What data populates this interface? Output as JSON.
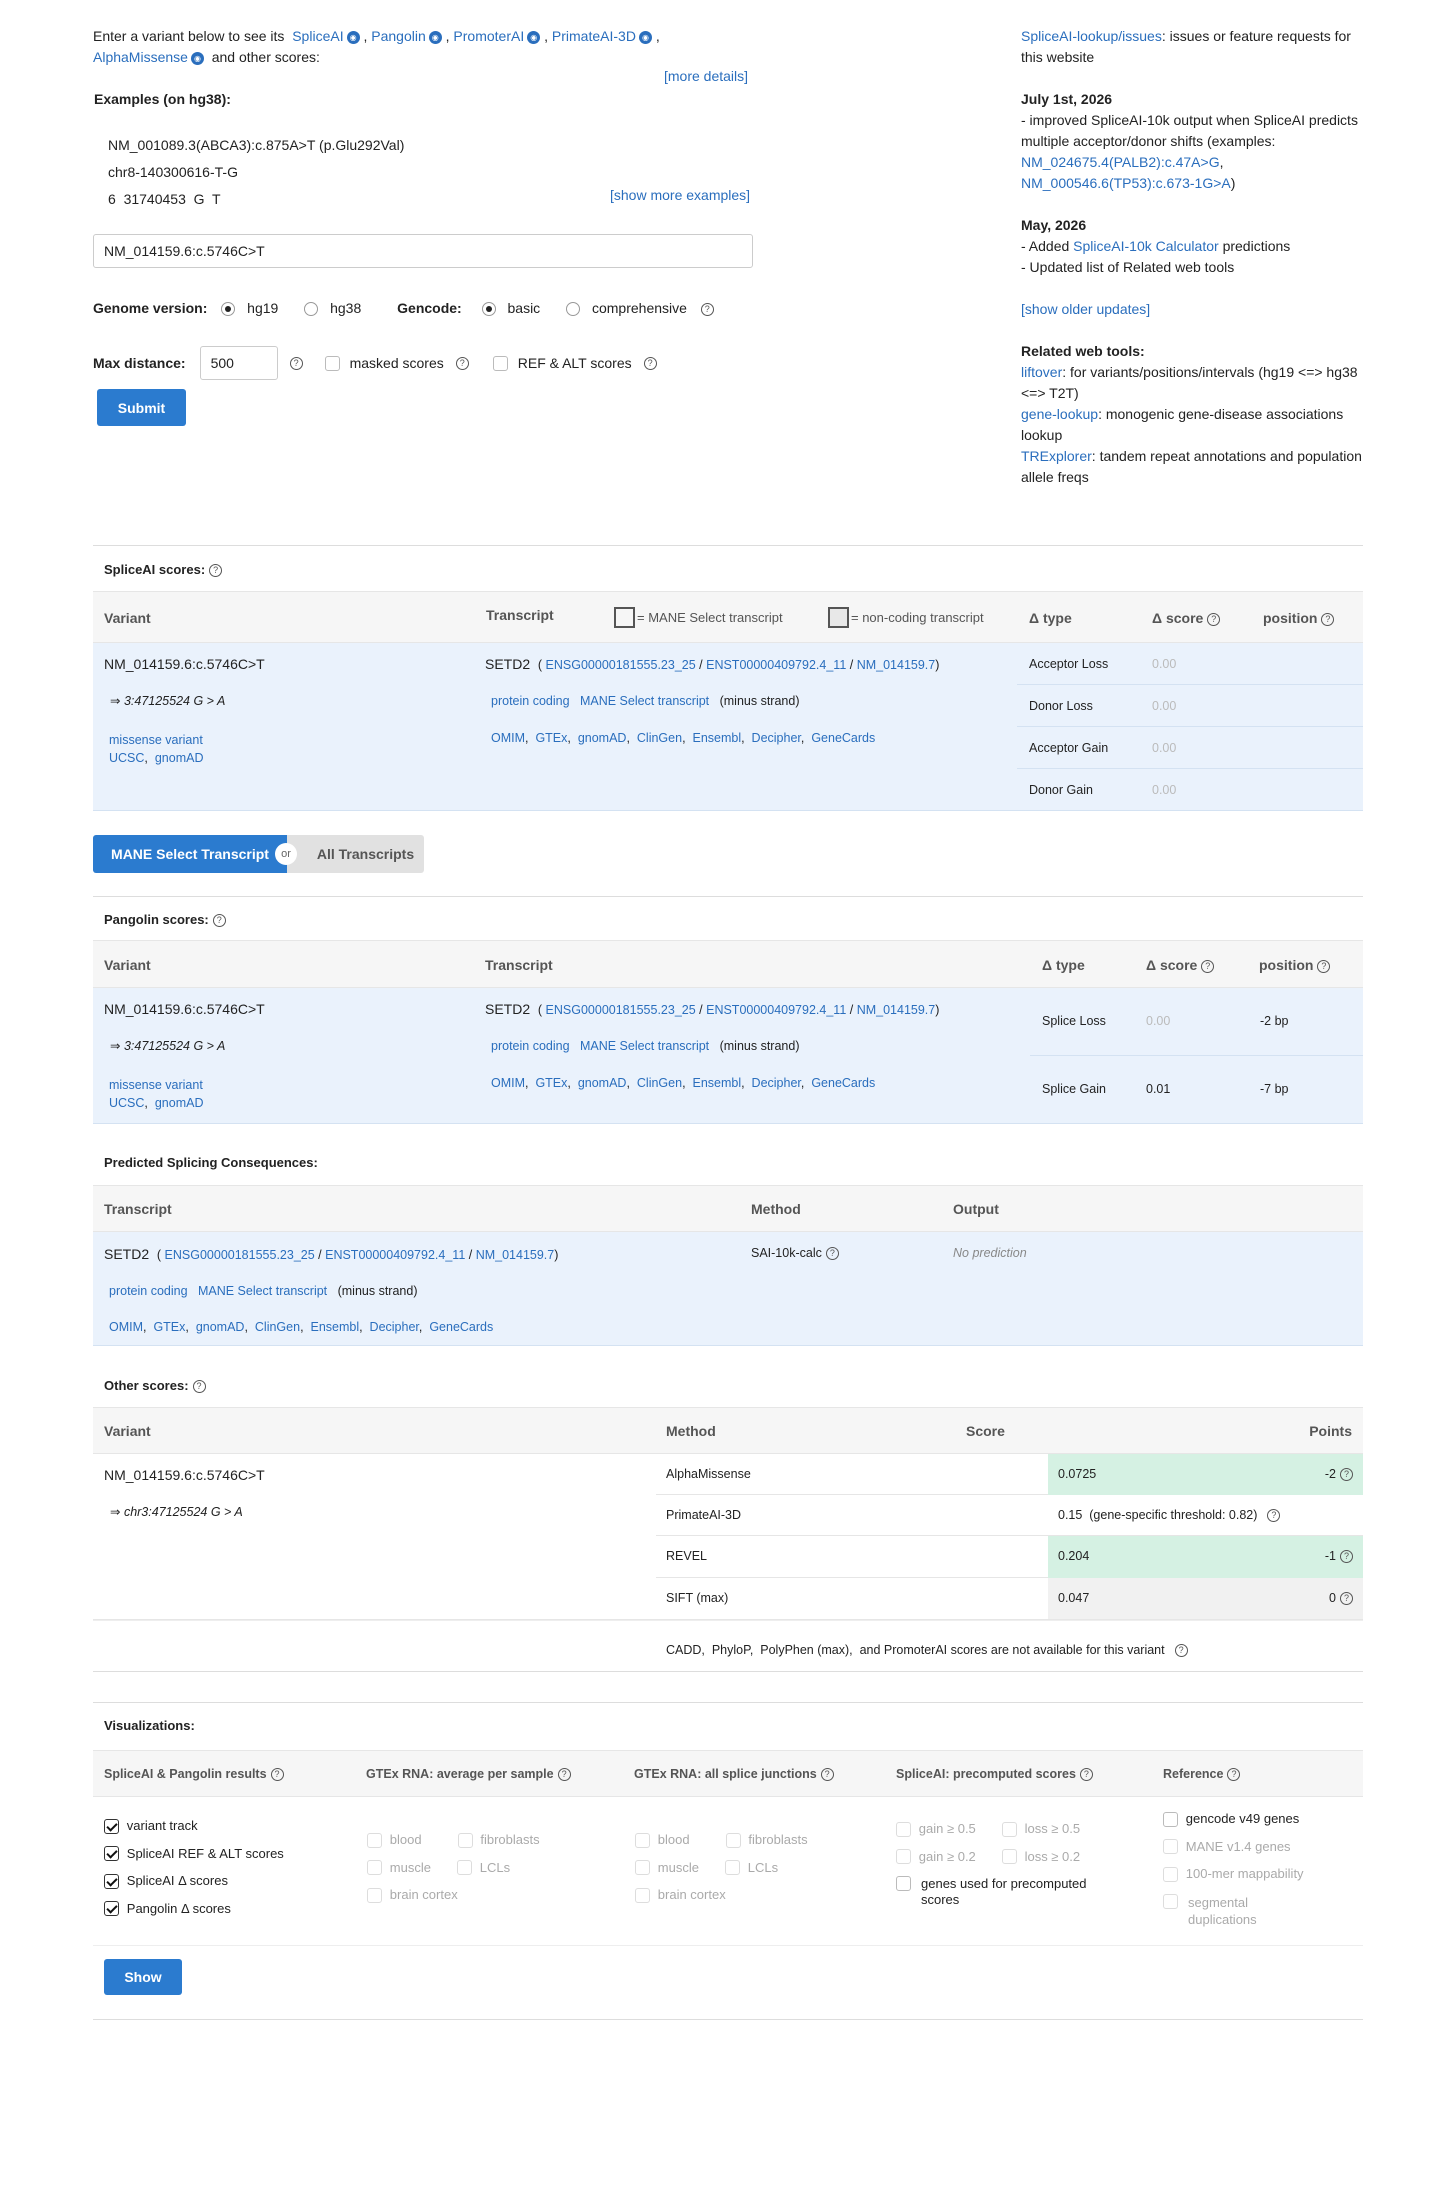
{
  "intro": {
    "prefix": "Enter a variant below to see its",
    "tools": [
      "SpliceAI",
      "Pangolin",
      "PromoterAI",
      "PrimateAI-3D",
      "AlphaMissense"
    ],
    "suffix": "and other scores:",
    "more_details": "[more details]"
  },
  "examples": {
    "title": "Examples   (on hg38):",
    "items": [
      "NM_001089.3(ABCA3):c.875A>T (p.Glu292Val)",
      "chr8-140300616-T-G",
      "6  31740453  G  T"
    ],
    "show_more": "[show more examples]"
  },
  "input": {
    "value": "NM_014159.6:c.5746C>T"
  },
  "options": {
    "genome_label": "Genome version:",
    "genome": [
      {
        "label": "hg19",
        "on": true
      },
      {
        "label": "hg38",
        "on": false
      }
    ],
    "gencode_label": "Gencode:",
    "gencode": [
      {
        "label": "basic",
        "on": true
      },
      {
        "label": "comprehensive",
        "on": false
      }
    ],
    "max_distance_label": "Max distance:",
    "max_distance": "500",
    "masked": "masked scores",
    "refalt": "REF & ALT scores",
    "submit": "Submit"
  },
  "sidebar": {
    "issues_link": "SpliceAI-lookup/issues",
    "issues_text": ": issues or feature requests for this website",
    "update1_date": "July 1st, 2026",
    "update1_text": "- improved SpliceAI-10k output when SpliceAI predicts multiple acceptor/donor shifts (examples:",
    "update1_ex1": "NM_024675.4(PALB2):c.47A>G",
    "update1_ex2": "NM_000546.6(TP53):c.673-1G>A",
    "update2_date": "May, 2026",
    "update2_pre": "- Added",
    "update2_link": "SpliceAI-10k Calculator",
    "update2_post": "predictions",
    "update2_line2": "- Updated list of Related web tools",
    "older": "[show older updates]",
    "related_title": "Related web tools:",
    "related": [
      {
        "link": "liftover",
        "text": ": for variants/positions/intervals (hg19 <=> hg38 <=> T2T)"
      },
      {
        "link": "gene-lookup",
        "text": ": monogenic gene-disease associations lookup"
      },
      {
        "link": "TRExplorer",
        "text": ": tandem repeat annotations and population allele freqs"
      }
    ]
  },
  "spliceai": {
    "title": "SpliceAI scores:",
    "h_variant": "Variant",
    "h_transcript": "Transcript",
    "h_mane": "= MANE Select transcript",
    "h_noncoding": "= non-coding transcript",
    "h_type": "Δ type",
    "h_score": "Δ score",
    "h_position": "position",
    "variant": "NM_014159.6:c.5746C>T",
    "variant_pos": "⇒ 3:47125524 G > A",
    "consequence": "missense variant",
    "ucsc": "UCSC",
    "gnomad": "gnomAD",
    "gene": "SETD2",
    "ids": [
      "ENSG00000181555.23_25",
      "ENST00000409792.4_11",
      "NM_014159.7"
    ],
    "biotype": "protein coding",
    "mane": "MANE Select transcript",
    "strand": "(minus strand)",
    "links": [
      "OMIM",
      "GTEx",
      "gnomAD",
      "ClinGen",
      "Ensembl",
      "Decipher",
      "GeneCards"
    ],
    "rows": [
      {
        "type": "Acceptor Loss",
        "score": "0.00"
      },
      {
        "type": "Donor Loss",
        "score": "0.00"
      },
      {
        "type": "Acceptor Gain",
        "score": "0.00"
      },
      {
        "type": "Donor Gain",
        "score": "0.00"
      }
    ]
  },
  "toggle": {
    "mane": "MANE Select Transcript",
    "or": "or",
    "all": "All Transcripts"
  },
  "pangolin": {
    "title": "Pangolin scores:",
    "h_variant": "Variant",
    "h_transcript": "Transcript",
    "h_type": "Δ type",
    "h_score": "Δ score",
    "h_position": "position",
    "variant": "NM_014159.6:c.5746C>T",
    "variant_pos": "⇒ 3:47125524 G > A",
    "consequence": "missense variant",
    "ucsc": "UCSC",
    "gnomad": "gnomAD",
    "gene": "SETD2",
    "ids": [
      "ENSG00000181555.23_25",
      "ENST00000409792.4_11",
      "NM_014159.7"
    ],
    "biotype": "protein coding",
    "mane": "MANE Select transcript",
    "strand": "(minus strand)",
    "links": [
      "OMIM",
      "GTEx",
      "gnomAD",
      "ClinGen",
      "Ensembl",
      "Decipher",
      "GeneCards"
    ],
    "rows": [
      {
        "type": "Splice Loss",
        "score": "0.00",
        "position": "-2 bp"
      },
      {
        "type": "Splice Gain",
        "score": "0.01",
        "position": "-7 bp"
      }
    ]
  },
  "consequences": {
    "title": "Predicted Splicing Consequences:",
    "h_transcript": "Transcript",
    "h_method": "Method",
    "h_output": "Output",
    "gene": "SETD2",
    "ids": [
      "ENSG00000181555.23_25",
      "ENST00000409792.4_11",
      "NM_014159.7"
    ],
    "biotype": "protein coding",
    "mane": "MANE Select transcript",
    "strand": "(minus strand)",
    "links": [
      "OMIM",
      "GTEx",
      "gnomAD",
      "ClinGen",
      "Ensembl",
      "Decipher",
      "GeneCards"
    ],
    "method": "SAI-10k-calc",
    "output": "No prediction"
  },
  "other": {
    "title": "Other scores:",
    "h_variant": "Variant",
    "h_method": "Method",
    "h_score": "Score",
    "h_points": "Points",
    "variant": "NM_014159.6:c.5746C>T",
    "variant_pos": "⇒ chr3:47125524 G > A",
    "rows": [
      {
        "method": "AlphaMissense",
        "score": "0.0725",
        "points": "-2"
      },
      {
        "method": "PrimateAI-3D",
        "score": "0.15  (gene-specific threshold: 0.82)",
        "points": ""
      },
      {
        "method": "REVEL",
        "score": "0.204",
        "points": "-1"
      },
      {
        "method": "SIFT (max)",
        "score": "0.047",
        "points": "0"
      }
    ],
    "note": "CADD,  PhyloP,  PolyPhen (max),  and PromoterAI scores are not available for this variant"
  },
  "vis": {
    "title": "Visualizations:",
    "headers": [
      "SpliceAI & Pangolin results",
      "GTEx RNA: average per sample",
      "GTEx RNA: all splice junctions",
      "SpliceAI: precomputed scores",
      "Reference"
    ],
    "results": [
      "variant track",
      "SpliceAI REF & ALT scores",
      "SpliceAI Δ scores",
      "Pangolin Δ scores"
    ],
    "gtex_avg": [
      "blood",
      "fibroblasts",
      "muscle",
      "LCLs",
      "brain cortex"
    ],
    "gtex_junc": [
      "blood",
      "fibroblasts",
      "muscle",
      "LCLs",
      "brain cortex"
    ],
    "precomp": [
      "gain ≥ 0.5",
      "loss ≥ 0.5",
      "gain ≥ 0.2",
      "loss ≥ 0.2",
      "genes used for precomputed scores"
    ],
    "reference": [
      "gencode v49 genes",
      "MANE v1.4 genes",
      "100-mer mappability",
      "segmental duplications"
    ],
    "show": "Show"
  }
}
